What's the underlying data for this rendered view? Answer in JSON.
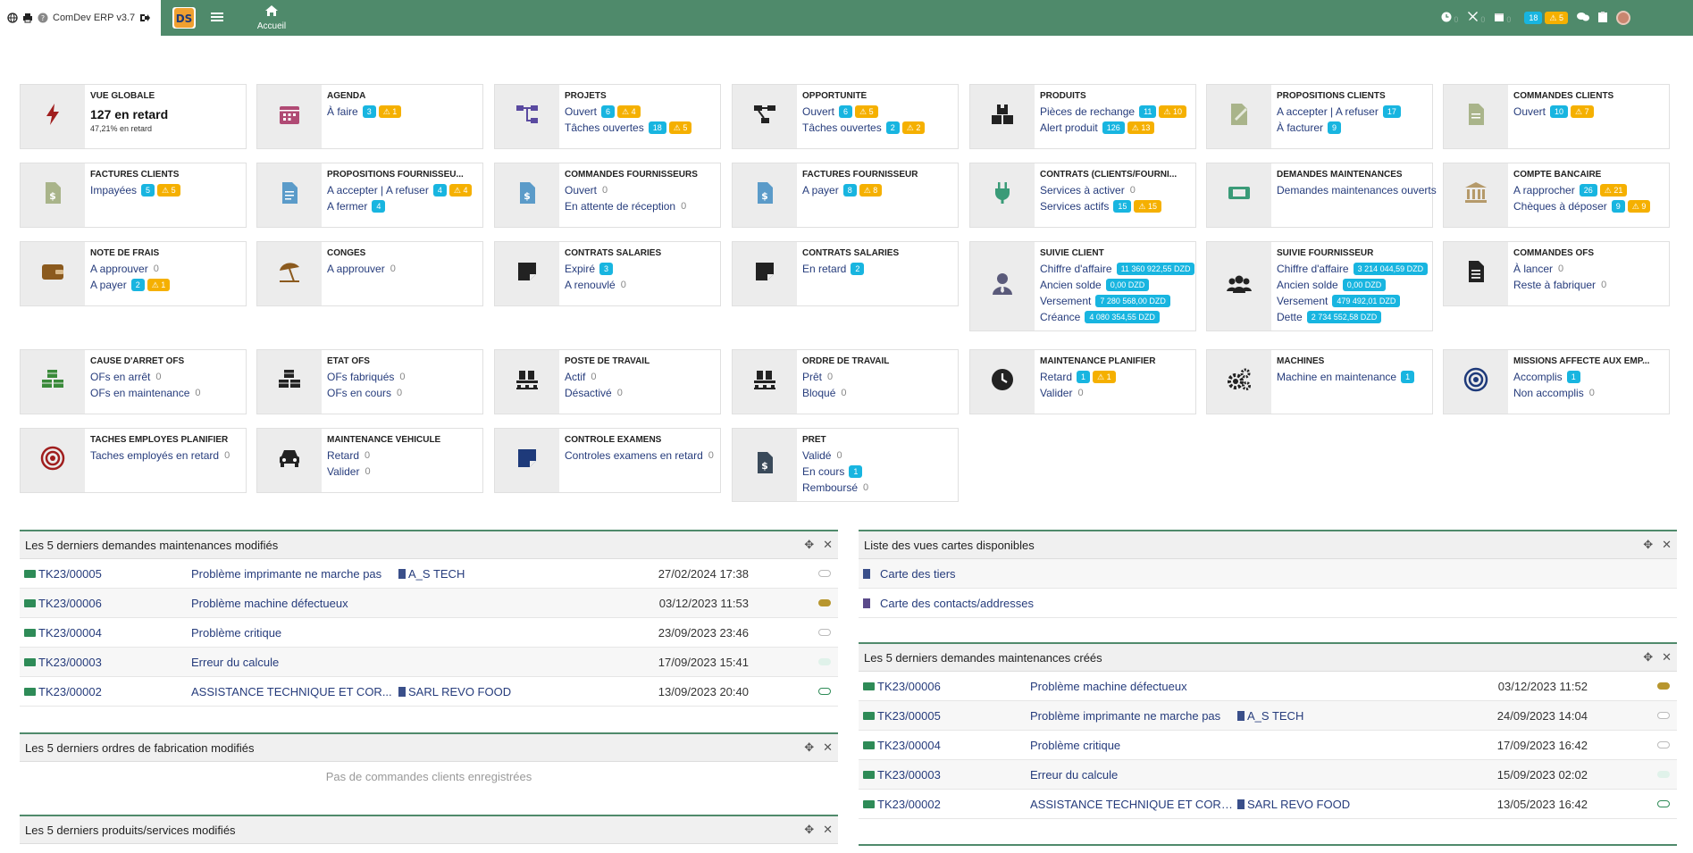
{
  "app": {
    "title": "ComDev ERP v3.7",
    "home_label": "Accueil"
  },
  "topbar": {
    "badge_count": "18",
    "badge_warn": "5"
  },
  "boxes": [
    {
      "title": "VUE GLOBALE",
      "icon": "bolt-icon",
      "color": "#a01e1e",
      "lines": [
        {
          "label": "127 en retard",
          "big": true
        },
        {
          "label": "47,21% en retard",
          "small": true
        }
      ]
    },
    {
      "title": "AGENDA",
      "icon": "calendar-icon",
      "color": "#b04a74",
      "lines": [
        {
          "label": "À faire",
          "badge": "3",
          "warn": "1"
        }
      ]
    },
    {
      "title": "PROJETS",
      "icon": "sitemap-icon",
      "color": "#5a4aa0",
      "lines": [
        {
          "label": "Ouvert",
          "badge": "6",
          "warn": "4"
        },
        {
          "label": "Tâches ouvertes",
          "badge": "18",
          "warn": "5"
        }
      ]
    },
    {
      "title": "OPPORTUNITÉ",
      "icon": "project-diagram-icon",
      "color": "#222",
      "lines": [
        {
          "label": "Ouvert",
          "badge": "6",
          "warn": "5"
        },
        {
          "label": "Tâches ouvertes",
          "badge": "2",
          "warn": "2"
        }
      ]
    },
    {
      "title": "PRODUITS",
      "icon": "boxes-icon",
      "color": "#222",
      "lines": [
        {
          "label": "Pièces de rechange",
          "badge": "11",
          "warn": "10"
        },
        {
          "label": "Alert produit",
          "badge": "126",
          "warn": "13"
        }
      ]
    },
    {
      "title": "PROPOSITIONS CLIENTS",
      "icon": "file-signature-icon",
      "color": "#a9b48a",
      "lines": [
        {
          "label": "A accepter | A refuser",
          "badge": "17"
        },
        {
          "label": "À facturer",
          "badge": "9"
        }
      ]
    },
    {
      "title": "COMMANDES CLIENTS",
      "icon": "file-icon",
      "color": "#a9b48a",
      "lines": [
        {
          "label": "Ouvert",
          "badge": "10",
          "warn": "7"
        }
      ]
    },
    {
      "title": "FACTURES CLIENTS",
      "icon": "file-invoice-dollar-icon",
      "color": "#a9b48a",
      "lines": [
        {
          "label": "Impayées",
          "badge": "5",
          "warn": "5"
        }
      ]
    },
    {
      "title": "PROPOSITIONS FOURNISSEU...",
      "icon": "file-alt-icon",
      "color": "#5b9bc9",
      "lines": [
        {
          "label": "A accepter | A refuser",
          "badge": "4",
          "warn": "4"
        },
        {
          "label": "A fermer",
          "badge": "4"
        }
      ]
    },
    {
      "title": "COMMANDES FOURNISSEURS",
      "icon": "file-dollar-icon",
      "color": "#5b9bc9",
      "lines": [
        {
          "label": "Ouvert",
          "zero": "0"
        },
        {
          "label": "En attente de réception",
          "zero": "0"
        }
      ]
    },
    {
      "title": "FACTURES FOURNISSEUR",
      "icon": "file-invoice-icon",
      "color": "#5b9bc9",
      "lines": [
        {
          "label": "A payer",
          "badge": "8",
          "warn": "8"
        }
      ]
    },
    {
      "title": "CONTRATS (CLIENTS/FOURNI...",
      "icon": "plug-icon",
      "color": "#3a9b78",
      "lines": [
        {
          "label": "Services à activer",
          "zero": "0"
        },
        {
          "label": "Services actifs",
          "badge": "15",
          "warn": "15"
        }
      ]
    },
    {
      "title": "DEMANDES MAINTENANCES",
      "icon": "ticket-icon",
      "color": "#3a9b78",
      "lines": [
        {
          "label": "Demandes maintenances ouverts"
        }
      ]
    },
    {
      "title": "COMPTE BANCAIRE",
      "icon": "bank-icon",
      "color": "#b59a6a",
      "lines": [
        {
          "label": "A rapprocher",
          "badge": "26",
          "warn": "21"
        },
        {
          "label": "Chèques à déposer",
          "badge": "9",
          "warn": "9"
        }
      ]
    },
    {
      "title": "NOTE DE FRAIS",
      "icon": "wallet-icon",
      "color": "#8b5a1e",
      "lines": [
        {
          "label": "A approuver",
          "zero": "0"
        },
        {
          "label": "A payer",
          "badge": "2",
          "warn": "1"
        }
      ]
    },
    {
      "title": "CONGÉS",
      "icon": "umbrella-beach-icon",
      "color": "#8b5a1e",
      "lines": [
        {
          "label": "A approuver",
          "zero": "0"
        }
      ]
    },
    {
      "title": "CONTRATS SALARIÉS",
      "icon": "sticky-note-icon",
      "color": "#222",
      "lines": [
        {
          "label": "Expiré",
          "badge": "3"
        },
        {
          "label": "A renouvlé",
          "zero": "0"
        }
      ]
    },
    {
      "title": "CONTRATS SALARIÉS",
      "icon": "sticky-note-icon",
      "color": "#222",
      "lines": [
        {
          "label": "En retard",
          "badge": "2"
        }
      ]
    },
    {
      "title": "SUIVIE CLIENT",
      "icon": "user-tie-icon",
      "color": "#5a5a7a",
      "lines": [
        {
          "label": "Chiffre d'affaire",
          "badge": "11 360 922,55 DZD"
        },
        {
          "label": "Ancien solde",
          "badge": "0,00 DZD"
        },
        {
          "label": "Versement",
          "badge": "7 280 568,00 DZD"
        },
        {
          "label": "Créance",
          "badge": "4 080 354,55 DZD"
        }
      ]
    },
    {
      "title": "SUIVIE FOURNISSEUR",
      "icon": "users-icon",
      "color": "#222",
      "lines": [
        {
          "label": "Chiffre d'affaire",
          "badge": "3 214 044,59 DZD"
        },
        {
          "label": "Ancien solde",
          "badge": "0,00 DZD"
        },
        {
          "label": "Versement",
          "badge": "479 492,01 DZD"
        },
        {
          "label": "Dette",
          "badge": "2 734 552,58 DZD"
        }
      ]
    },
    {
      "title": "COMMANDES OFS",
      "icon": "file-lines-icon",
      "color": "#222",
      "lines": [
        {
          "label": "À lancer",
          "zero": "0"
        },
        {
          "label": "Reste à fabriquer",
          "zero": "0"
        }
      ]
    },
    {
      "title": "CAUSE D'ARRÊT OFS",
      "icon": "cubes-icon",
      "color": "#3a8a3a",
      "lines": [
        {
          "label": "OFs en arrêt",
          "zero": "0"
        },
        {
          "label": "OFs en maintenance",
          "zero": "0"
        }
      ]
    },
    {
      "title": "ÉTAT OFS",
      "icon": "cubes-icon",
      "color": "#222",
      "lines": [
        {
          "label": "OFs fabriqués",
          "zero": "0"
        },
        {
          "label": "OFs en cours",
          "zero": "0"
        }
      ]
    },
    {
      "title": "POSTE DE TRAVAIL",
      "icon": "pallet-icon",
      "color": "#222",
      "lines": [
        {
          "label": "Actif",
          "zero": "0"
        },
        {
          "label": "Désactivé",
          "zero": "0"
        }
      ]
    },
    {
      "title": "ORDRE DE TRAVAIL",
      "icon": "pallet-icon",
      "color": "#222",
      "lines": [
        {
          "label": "Prêt",
          "zero": "0"
        },
        {
          "label": "Bloqué",
          "zero": "0"
        }
      ]
    },
    {
      "title": "MAINTENANCE PLANIFIER",
      "icon": "clock-icon",
      "color": "#222",
      "lines": [
        {
          "label": "Retard",
          "badge": "1",
          "warn": "1"
        },
        {
          "label": "Valider",
          "zero": "0"
        }
      ]
    },
    {
      "title": "MACHINES",
      "icon": "cogs-icon",
      "color": "#222",
      "lines": [
        {
          "label": "Machine en maintenance",
          "badge": "1"
        }
      ]
    },
    {
      "title": "MISSIONS AFFECTÉ AUX EMP...",
      "icon": "bullseye-icon",
      "color": "#1e3a7a",
      "lines": [
        {
          "label": "Accomplis",
          "badge": "1"
        },
        {
          "label": "Non accomplis",
          "zero": "0"
        }
      ]
    },
    {
      "title": "TACHES EMPLOYÉS PLANIFIER",
      "icon": "target-icon",
      "color": "#a01e1e",
      "lines": [
        {
          "label": "Taches employés en retard",
          "zero": "0"
        }
      ]
    },
    {
      "title": "MAINTENANCE VÉHICULE",
      "icon": "car-icon",
      "color": "#222",
      "lines": [
        {
          "label": "Retard",
          "zero": "0"
        },
        {
          "label": "Valider",
          "zero": "0"
        }
      ]
    },
    {
      "title": "CONTROLE EXAMENS",
      "icon": "note-icon",
      "color": "#1e3a7a",
      "lines": [
        {
          "label": "Controles examens en retard",
          "zero": "0"
        }
      ]
    },
    {
      "title": "PRÊT",
      "icon": "file-invoice-dollar-icon",
      "color": "#3a4a5a",
      "lines": [
        {
          "label": "Validé",
          "zero": "0"
        },
        {
          "label": "En cours",
          "badge": "1"
        },
        {
          "label": "Remboursé",
          "zero": "0"
        }
      ]
    }
  ],
  "panels": {
    "maint_modified": {
      "title": "Les 5 derniers demandes maintenances modifiés",
      "rows": [
        {
          "ref": "TK23/00005",
          "label": "Problème imprimante ne marche pas",
          "company": "A_S TECH",
          "date": "27/02/2024 17:38",
          "status": "#ffffff",
          "border": "#bbbbbb"
        },
        {
          "ref": "TK23/00006",
          "label": "Problème machine défectueux",
          "company": "",
          "date": "03/12/2023 11:53",
          "status": "#b8962e",
          "border": "#b8962e"
        },
        {
          "ref": "TK23/00004",
          "label": "Problème critique",
          "company": "",
          "date": "23/09/2023 23:46",
          "status": "#ffffff",
          "border": "#bbbbbb"
        },
        {
          "ref": "TK23/00003",
          "label": "Erreur du calcule",
          "company": "",
          "date": "17/09/2023 15:41",
          "status": "#e0f2ea",
          "border": "#e0f2ea"
        },
        {
          "ref": "TK23/00002",
          "label": "ASSISTANCE TECHNIQUE ET COR...",
          "company": "SARL REVO FOOD",
          "date": "13/09/2023 20:40",
          "status": "#ffffff",
          "border": "#2e8b57"
        }
      ]
    },
    "of_modified": {
      "title": "Les 5 derniers ordres de fabrication modifiés",
      "empty": "Pas de commandes clients enregistrées"
    },
    "products_modified": {
      "title": "Les 5 derniers produits/services modifiés"
    },
    "maps": {
      "title": "Liste des vues cartes disponibles",
      "rows": [
        {
          "label": "Carte des tiers"
        },
        {
          "label": "Carte des contacts/addresses"
        }
      ]
    },
    "maint_created": {
      "title": "Les 5 derniers demandes maintenances créés",
      "rows": [
        {
          "ref": "TK23/00006",
          "label": "Problème machine défectueux",
          "company": "",
          "date": "03/12/2023 11:52",
          "status": "#b8962e",
          "border": "#b8962e"
        },
        {
          "ref": "TK23/00005",
          "label": "Problème imprimante ne marche pas",
          "company": "A_S TECH",
          "date": "24/09/2023 14:04",
          "status": "#ffffff",
          "border": "#bbbbbb"
        },
        {
          "ref": "TK23/00004",
          "label": "Problème critique",
          "company": "",
          "date": "17/09/2023 16:42",
          "status": "#ffffff",
          "border": "#bbbbbb"
        },
        {
          "ref": "TK23/00003",
          "label": "Erreur du calcule",
          "company": "",
          "date": "15/09/2023 02:02",
          "status": "#e0f2ea",
          "border": "#e0f2ea"
        },
        {
          "ref": "TK23/00002",
          "label": "ASSISTANCE TECHNIQUE ET CORRECTION DE...",
          "company": "SARL REVO FOOD",
          "date": "13/05/2023 16:42",
          "status": "#ffffff",
          "border": "#2e8b57"
        }
      ]
    }
  }
}
